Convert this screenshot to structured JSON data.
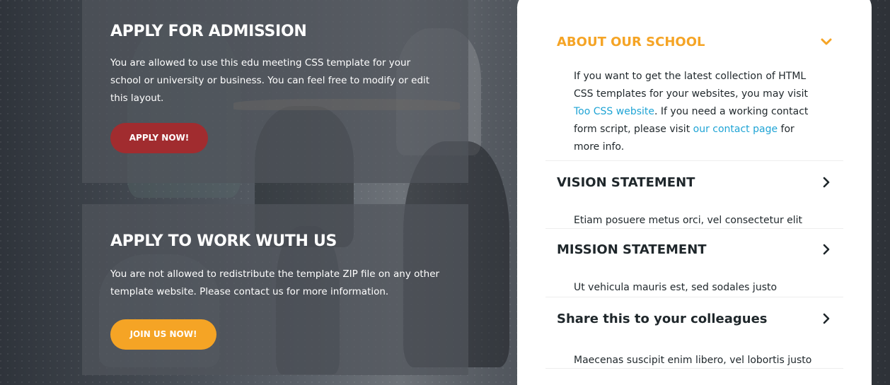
{
  "cards": [
    {
      "title": "APPLY FOR ADMISSION",
      "text": "You are allowed to use this edu meeting CSS template for your school or university or business. You can feel free to modify or edit this layout.",
      "button": "APPLY NOW!"
    },
    {
      "title": "APPLY TO WORK WUTH US",
      "text": "You are not allowed to redistribute the template ZIP file on any other template website. Please contact us for more information.",
      "button": "JOIN US NOW!"
    }
  ],
  "accordion": {
    "items": [
      {
        "title": "ABOUT OUR SCHOOL",
        "expanded": true,
        "body_part1": "If you want to get the latest collection of HTML CSS templates for your websites, you may visit ",
        "link1": "Too CSS website",
        "body_part2": ". If you need a working contact form script, please visit ",
        "link2": "our contact page",
        "body_part3": " for more info."
      },
      {
        "title": "VISION STATEMENT",
        "expanded": false,
        "body": "Etiam posuere metus orci, vel consectetur elit"
      },
      {
        "title": "MISSION STATEMENT",
        "expanded": false,
        "body": "Ut vehicula mauris est, sed sodales justo"
      },
      {
        "title": "Share this to your colleagues",
        "expanded": false,
        "body": "Maecenas suscipit enim libero, vel lobortis justo"
      }
    ]
  },
  "colors": {
    "accent": "#f5a425",
    "apply_button": "#a12c2f",
    "link": "#1fa4d5",
    "heading_dark": "#1f272b"
  },
  "icons": {
    "expanded": "chevron-down-icon",
    "collapsed": "chevron-right-icon"
  }
}
